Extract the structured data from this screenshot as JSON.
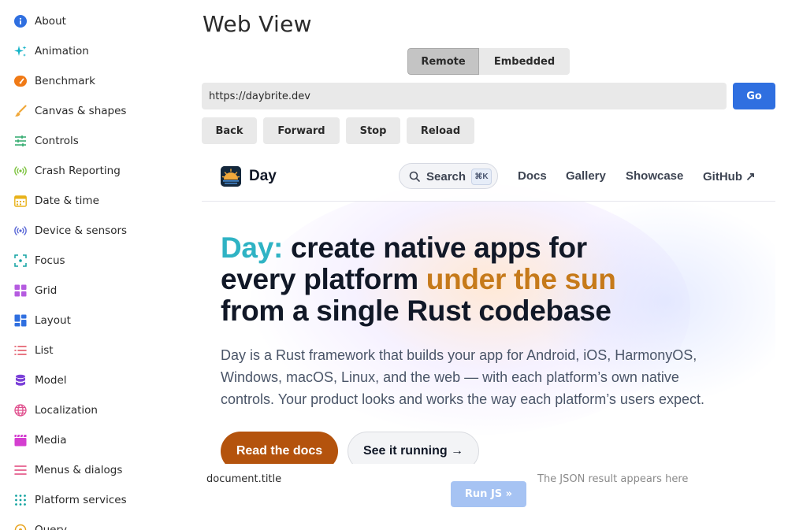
{
  "sidebar": {
    "items": [
      {
        "label": "About",
        "icon": "info-icon",
        "color": "#2f6fe0"
      },
      {
        "label": "Animation",
        "icon": "sparkle-icon",
        "color": "#13b3c7"
      },
      {
        "label": "Benchmark",
        "icon": "speedometer-icon",
        "color": "#f07a16"
      },
      {
        "label": "Canvas & shapes",
        "icon": "brush-icon",
        "color": "#f0a83a"
      },
      {
        "label": "Controls",
        "icon": "sliders-icon",
        "color": "#2ea86a"
      },
      {
        "label": "Crash Reporting",
        "icon": "broadcast-icon",
        "color": "#7cc23d"
      },
      {
        "label": "Date & time",
        "icon": "calendar-icon",
        "color": "#e8b21a"
      },
      {
        "label": "Device & sensors",
        "icon": "sensor-icon",
        "color": "#5866d6"
      },
      {
        "label": "Focus",
        "icon": "focus-icon",
        "color": "#14a3a3"
      },
      {
        "label": "Grid",
        "icon": "grid-icon",
        "color": "#b55be0"
      },
      {
        "label": "Layout",
        "icon": "layout-icon",
        "color": "#2f6fe0"
      },
      {
        "label": "List",
        "icon": "list-icon",
        "color": "#e04a5a"
      },
      {
        "label": "Model",
        "icon": "database-icon",
        "color": "#7a3fd8"
      },
      {
        "label": "Localization",
        "icon": "globe-icon",
        "color": "#e0508e"
      },
      {
        "label": "Media",
        "icon": "clapperboard-icon",
        "color": "#d43fd0"
      },
      {
        "label": "Menus & dialogs",
        "icon": "menu-icon",
        "color": "#e0447a"
      },
      {
        "label": "Platform services",
        "icon": "dots-grid-icon",
        "color": "#13a3a0"
      },
      {
        "label": "Query",
        "icon": "query-icon",
        "color": "#e8a21a"
      }
    ]
  },
  "main": {
    "title": "Web View",
    "segments": {
      "remote": "Remote",
      "embedded": "Embedded"
    },
    "url": "https://daybrite.dev",
    "go_label": "Go",
    "nav": {
      "back": "Back",
      "forward": "Forward",
      "stop": "Stop",
      "reload": "Reload"
    }
  },
  "webview": {
    "brand": "Day",
    "search_label": "Search",
    "search_shortcut": "⌘K",
    "links": {
      "docs": "Docs",
      "gallery": "Gallery",
      "showcase": "Showcase",
      "github": "GitHub ↗"
    },
    "headline": {
      "part1": "Day:",
      "part2": " create native apps for",
      "part3": "every platform ",
      "part4": "under the sun",
      "part5": "from a single Rust codebase"
    },
    "paragraph": "Day is a Rust framework that builds your app for Android, iOS, HarmonyOS, Windows, macOS, Linux, and the web — with each platform’s own native controls. Your product looks and works the way each platform’s users expect.",
    "primary_button": "Read the docs",
    "secondary_button": "See it running →",
    "colors": {
      "accent_teal": "#2fb3c4",
      "accent_orange": "#c67a1a",
      "primary_btn": "#b4530d"
    }
  },
  "js": {
    "expression": "document.title",
    "run_label": "Run JS »",
    "result_placeholder": "The JSON result appears here"
  }
}
